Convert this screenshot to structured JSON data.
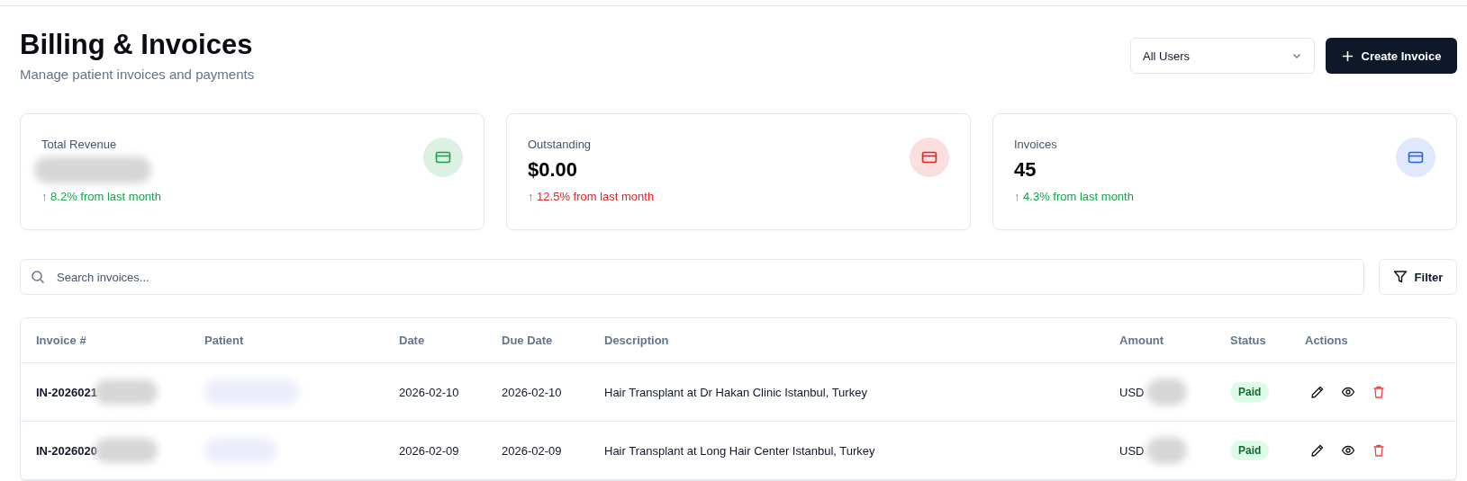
{
  "header": {
    "title": "Billing & Invoices",
    "subtitle": "Manage patient invoices and payments"
  },
  "user_filter": {
    "value": "All Users"
  },
  "create_button": {
    "label": "Create Invoice"
  },
  "stats": [
    {
      "label": "Total Revenue",
      "redacted": true,
      "kind": "positive",
      "change": "↑ 8.2% from last month",
      "color": "#16a34a"
    },
    {
      "label": "Outstanding",
      "value": "$0.00",
      "kind": "negative",
      "change": "↑ 12.5% from last month",
      "color": "#dc2626"
    },
    {
      "label": "Invoices",
      "value": "45",
      "kind": "positive",
      "change": "↑ 4.3% from last month",
      "color": "#2563eb"
    }
  ],
  "search": {
    "placeholder": "Search invoices..."
  },
  "filter_button": {
    "label": "Filter"
  },
  "table": {
    "columns": [
      "Invoice #",
      "Patient",
      "Date",
      "Due Date",
      "Description",
      "Amount",
      "Status",
      "Actions"
    ],
    "rows": [
      {
        "invoice": "IN-2026021",
        "date": "2026-02-10",
        "due_date": "2026-02-10",
        "description": "Hair Transplant at Dr Hakan Clinic Istanbul, Turkey",
        "amount": "USD",
        "status": "Paid",
        "kind": "paid"
      },
      {
        "invoice": "IN-2026020",
        "date": "2026-02-09",
        "due_date": "2026-02-09",
        "description": "Hair Transplant at Long Hair Center Istanbul, Turkey",
        "amount": "USD",
        "status": "Paid",
        "kind": "paid"
      }
    ]
  }
}
